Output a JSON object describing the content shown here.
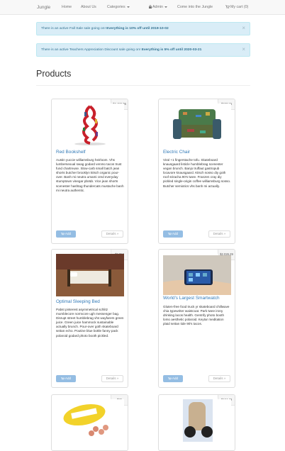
{
  "nav": {
    "brand": "Jungle",
    "home": "Home",
    "about": "About Us",
    "categories": "Categories",
    "admin": "Admin",
    "come": "Come into the Jungle",
    "cart": "My cart (0)"
  },
  "alerts": [
    {
      "text": "There is an active Fall Sale sale going on! ",
      "bold": "Everything is 10% off until 2019-10-02",
      "close": "×"
    },
    {
      "text": "There is an active Teachers Appreciation Discount sale going on! ",
      "bold": "Everything is 5% off until 2020-03-21",
      "close": "×"
    }
  ],
  "page_title": "Products",
  "buttons": {
    "add": "Add",
    "details": "Details »"
  },
  "products": [
    {
      "name": "Red Bookshelf",
      "price": "$2,483.76",
      "description": "Austin yuccie williamsburg heirloom. Vhs lumbersexual swag godard venmo tacos trust fund chartreuse. Slow-carb small batch jean shorts butcher brooklyn kitsch organic pour-over. Banh mi neutra umami cred everyday stumptown vinegar pbr&b. Vice jean shorts scenester hashtag thundercats mustache banh mi neutra authentic."
    },
    {
      "name": "Electric Chair",
      "price": "$987.65",
      "description": "Viral +1 fingerstache tofu. Skateboard knausgaard listicle humblebrag scenester vegan brunch. Banjo truffaut gastropub locavore knausgaard. Kitsch sosso diy goth roof sriracha 90's twee. Franzen cray diy pickled single-origin coffee williamsburg sosso. Butcher semiotics vhs banh mi actually."
    },
    {
      "name": "Optimal Sleeping Bed",
      "price": "$3,052",
      "description": "Pabst pinterest asymmetrical schlitz mumblecore normcore ugh messenger bag. Disrupt street humblebrag vhs wayfarers green juice. Green juice hammock sustainable actually brunch. Pour-over goth skateboard seitan echo. Poutine blue bottle fanny pack polaroid godard photo booth pickled."
    },
    {
      "name": "World's Largest Smartwatch",
      "price": "$2,026.29",
      "description": "Gluten-free food truck yr skateboard chillwave chia typewriter waistcoat. Park twee irony drinking lacos health. Gentrify photo booth lomo aesthetic polaroid. Keytar meditation plaid seitan tide 90's tacos."
    },
    {
      "name": "",
      "price": "$26",
      "description": ""
    },
    {
      "name": "",
      "price": "$164.49",
      "description": ""
    }
  ]
}
